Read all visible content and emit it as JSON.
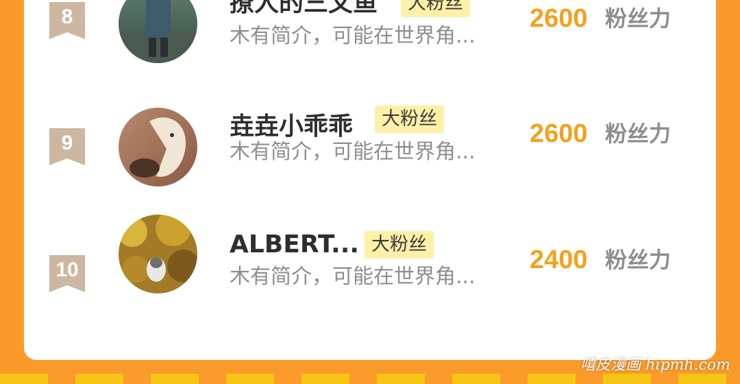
{
  "colors": {
    "frame": "#fa9a2b",
    "card": "#ffffff",
    "score": "#f4a11e",
    "badge_bg": "#fdf0a8",
    "rank_ribbon": "#cdb7a0"
  },
  "ranking": {
    "rows": [
      {
        "rank": "8",
        "name": "撩人的三文鱼",
        "badge": "大粉丝",
        "desc": "木有简介，可能在世界角...",
        "score": "2600",
        "score_unit": "粉丝力",
        "avatar_icon": "avatar-person-photo"
      },
      {
        "rank": "9",
        "name": "垚垚小乖乖",
        "badge": "大粉丝",
        "desc": "木有简介，可能在世界角...",
        "score": "2600",
        "score_unit": "粉丝力",
        "avatar_icon": "avatar-horse-photo"
      },
      {
        "rank": "10",
        "name": "ALBERT...",
        "badge": "大粉丝",
        "desc": "木有简介，可能在世界角...",
        "score": "2400",
        "score_unit": "粉丝力",
        "avatar_icon": "avatar-autumn-dog-photo"
      }
    ]
  },
  "watermark": "嘻皮漫画 hipmh.com"
}
